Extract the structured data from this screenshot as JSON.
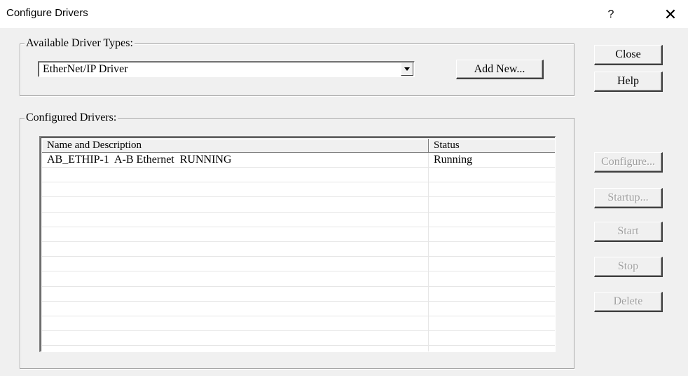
{
  "window": {
    "title": "Configure Drivers",
    "help_glyph": "?",
    "close_glyph": "✕"
  },
  "available_group": {
    "legend": "Available Driver Types:",
    "selected_driver": "EtherNet/IP Driver",
    "add_new_label": "Add New..."
  },
  "configured_group": {
    "legend": "Configured Drivers:",
    "columns": [
      "Name and Description",
      "Status"
    ],
    "rows": [
      {
        "name": "AB_ETHIP-1  A-B Ethernet  RUNNING",
        "status": "Running"
      }
    ],
    "empty_rows": 12
  },
  "side_buttons": {
    "close": "Close",
    "help": "Help",
    "configure": "Configure...",
    "startup": "Startup...",
    "start": "Start",
    "stop": "Stop",
    "delete": "Delete"
  },
  "colors": {
    "face": "#f0f0f0",
    "disabled_text": "#a0a0a0"
  }
}
